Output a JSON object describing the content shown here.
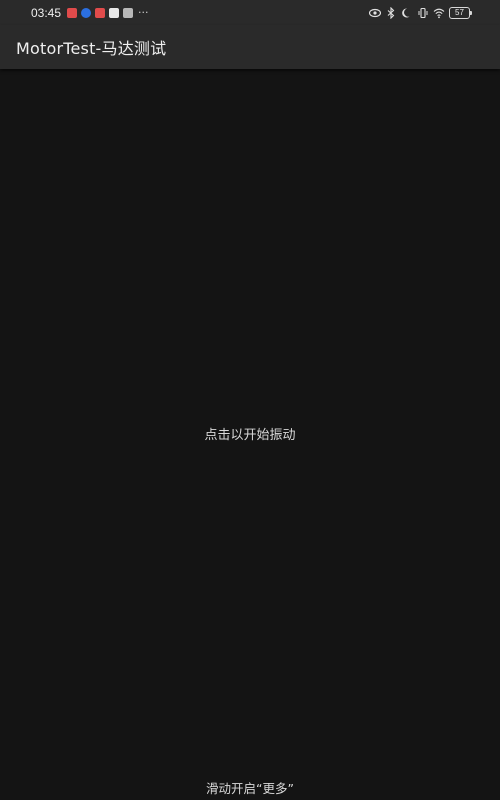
{
  "status_bar": {
    "time": "03:45",
    "more_indicator": "···",
    "battery_level": "57",
    "notification_icons": [
      "red-app-icon",
      "blue-app-icon",
      "red-app-icon",
      "white-app-icon",
      "gray-app-icon"
    ],
    "system_icons": [
      "eye-icon",
      "bluetooth-icon",
      "moon-icon",
      "vibrate-icon",
      "wifi-icon",
      "battery-icon"
    ]
  },
  "app_bar": {
    "title": "MotorTest-马达测试"
  },
  "main": {
    "center_text": "点击以开始振动",
    "bottom_hint": "滑动开启“更多”"
  },
  "colors": {
    "background": "#141414",
    "bar": "#2a2a2a",
    "text": "#e6e6e6"
  }
}
